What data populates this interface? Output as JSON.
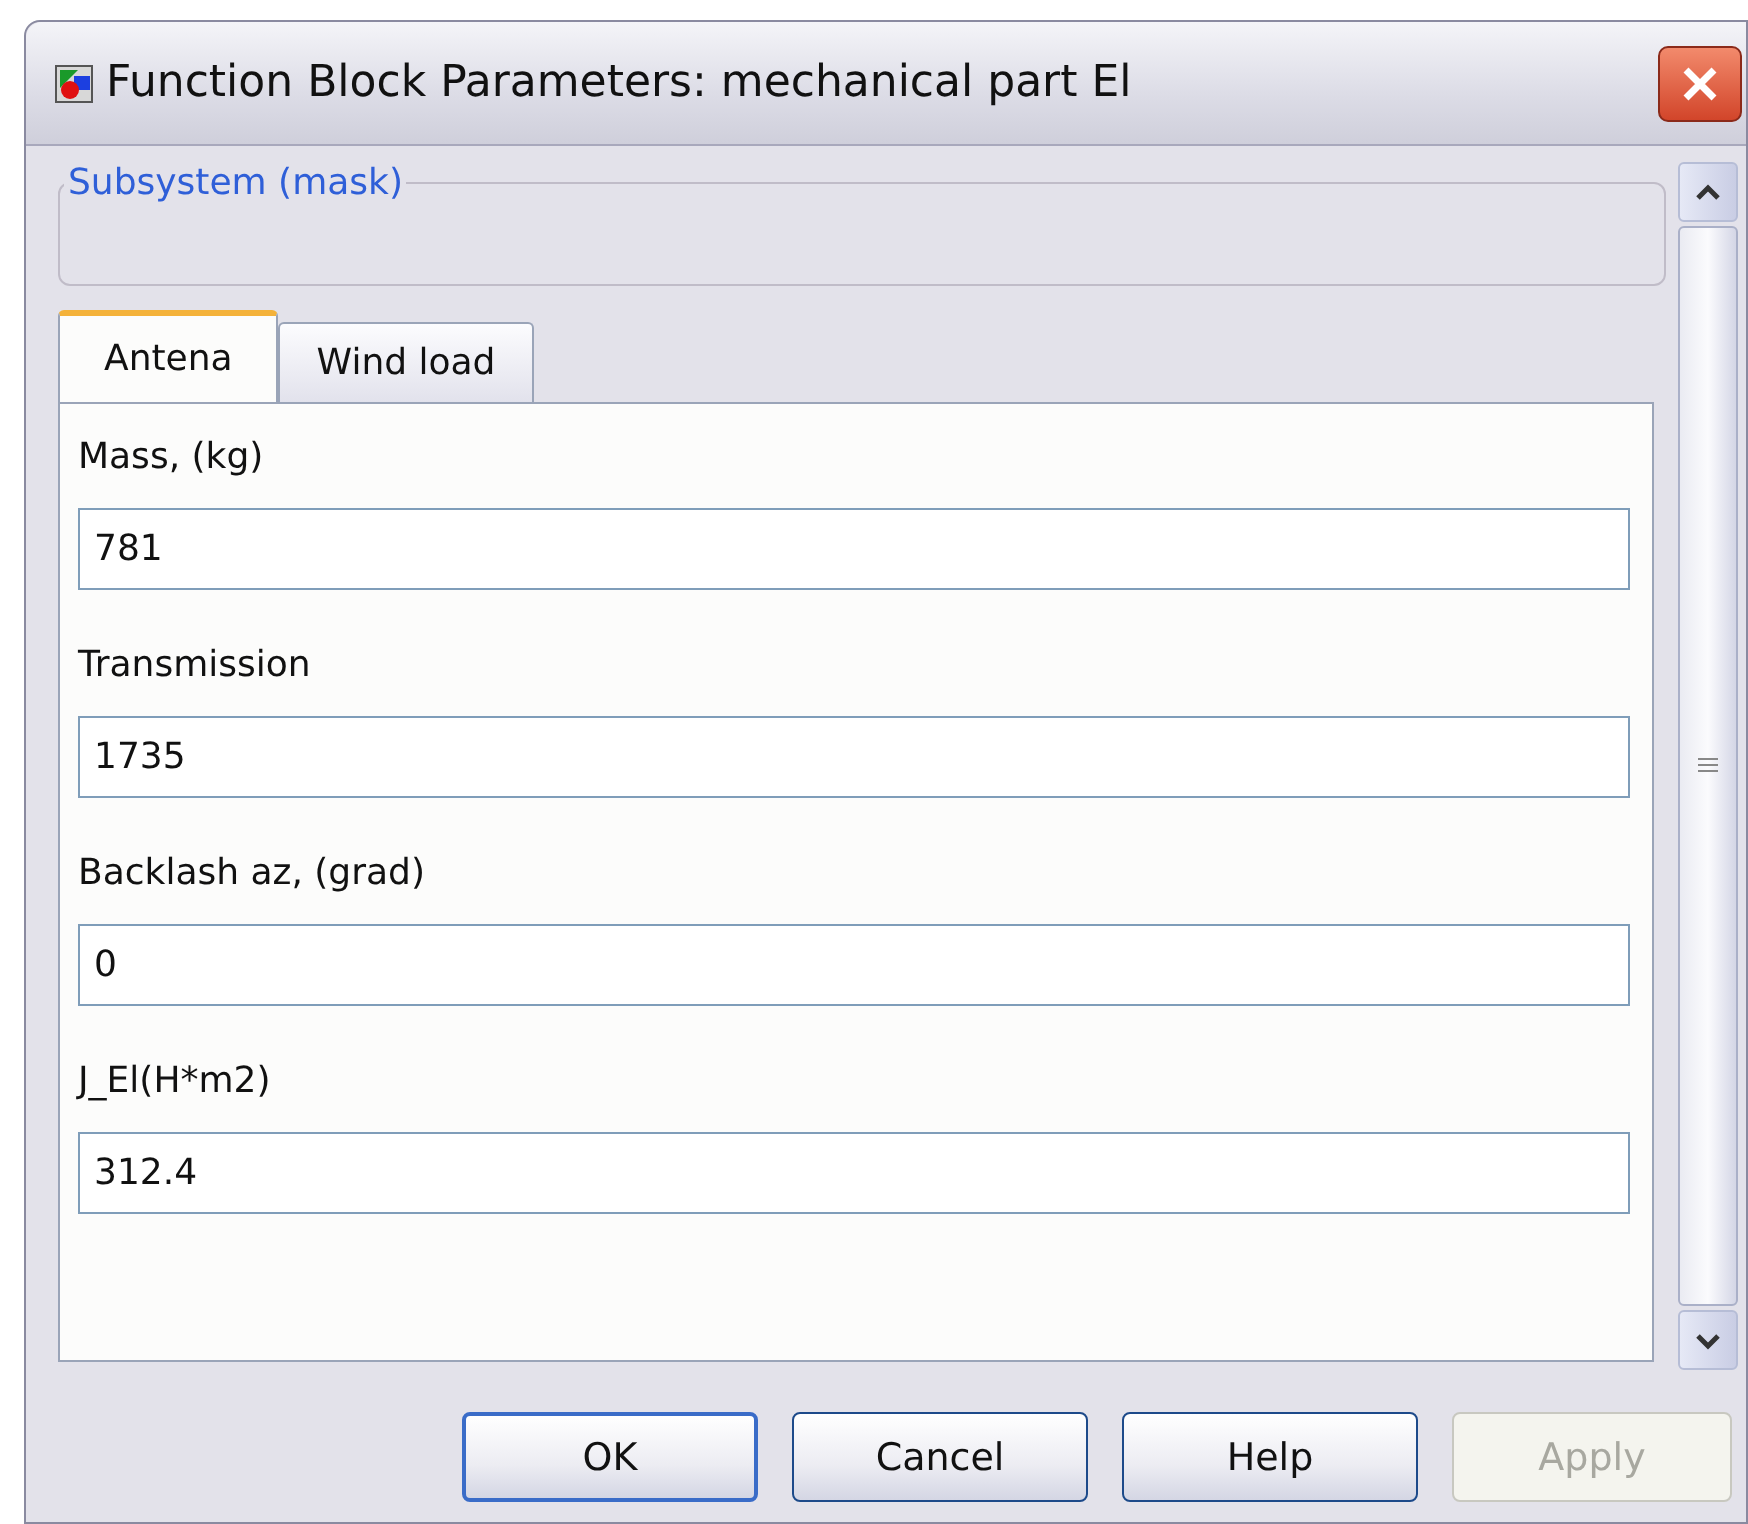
{
  "window": {
    "title": "Function Block Parameters: mechanical part El"
  },
  "group": {
    "label": "Subsystem (mask)"
  },
  "tabs": [
    {
      "label": "Antena",
      "selected": true
    },
    {
      "label": "Wind load",
      "selected": false
    }
  ],
  "parameters": [
    {
      "label": "Mass, (kg)",
      "value": "781"
    },
    {
      "label": "Transmission",
      "value": "1735"
    },
    {
      "label": "Backlash az, (grad)",
      "value": "0"
    },
    {
      "label": "J_El(H*m2)",
      "value": "312.4"
    }
  ],
  "buttons": [
    {
      "label": "OK",
      "default": true,
      "disabled": false
    },
    {
      "label": "Cancel",
      "default": false,
      "disabled": false
    },
    {
      "label": "Help",
      "default": false,
      "disabled": false
    },
    {
      "label": "Apply",
      "default": false,
      "disabled": true
    }
  ]
}
